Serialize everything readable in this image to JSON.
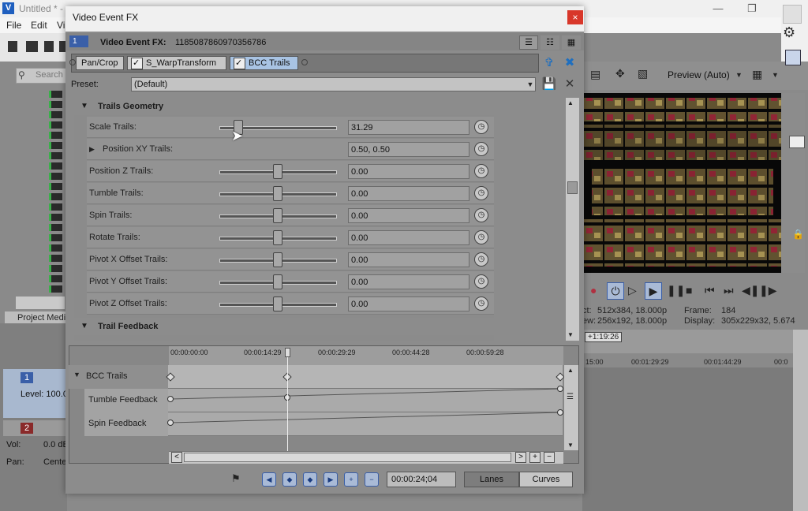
{
  "app": {
    "title": "Untitled * -",
    "menu": [
      "File",
      "Edit",
      "Vi"
    ],
    "search_placeholder": "Search",
    "project_media_tab": "Project Medi",
    "track1": {
      "number": "1",
      "level_label": "Level: 100.0"
    },
    "track2": {
      "number": "2",
      "vol_label": "Vol:",
      "vol_value": "0.0 dB",
      "pan_label": "Pan:",
      "pan_value": "Cente"
    }
  },
  "preview": {
    "mode_label": "Preview (Auto)",
    "info": {
      "project_label": "ct:",
      "project_value": "512x384, 18.000p",
      "frame_label": "Frame:",
      "frame_value": "184",
      "preview_label": "ew:",
      "preview_value": "256x192, 18.000p",
      "display_label": "Display:",
      "display_value": "305x229x32, 5.674"
    },
    "timecode": "+1:19:26",
    "ruler_labels": [
      "15:00",
      "00:01:29:29",
      "00:01:44:29",
      "00:0"
    ]
  },
  "dialog": {
    "title": "Video Event FX",
    "close_glyph": "×",
    "fx_badge": "1",
    "fx_title": "Video Event FX:",
    "fx_id": "1185087860970356786",
    "chain": [
      "Pan/Crop",
      "S_WarpTransform",
      "BCC Trails"
    ],
    "preset_label": "Preset:",
    "preset_value": "(Default)",
    "sections": {
      "geometry": "Trails Geometry",
      "feedback": "Trail Feedback"
    },
    "params": [
      {
        "label": "Scale Trails:",
        "value": "31.29",
        "level": 0.16
      },
      {
        "label": "Position XY Trails:",
        "value": "0.50, 0.50",
        "expandable": true
      },
      {
        "label": "Position Z Trails:",
        "value": "0.00",
        "level": 0.5
      },
      {
        "label": "Tumble Trails:",
        "value": "0.00",
        "level": 0.5
      },
      {
        "label": "Spin Trails:",
        "value": "0.00",
        "level": 0.5
      },
      {
        "label": "Rotate Trails:",
        "value": "0.00",
        "level": 0.5
      },
      {
        "label": "Pivot X Offset Trails:",
        "value": "0.00",
        "level": 0.5
      },
      {
        "label": "Pivot Y Offset Trails:",
        "value": "0.00",
        "level": 0.5
      },
      {
        "label": "Pivot Z Offset Trails:",
        "value": "0.00",
        "level": 0.5
      }
    ],
    "keyframes": {
      "ruler": [
        "00:00:00:00",
        "00:00:14:29",
        "00:00:29:29",
        "00:00:44:28",
        "00:00:59:28"
      ],
      "rows": [
        "BCC Trails",
        "Tumble Feedback",
        "Spin Feedback"
      ]
    },
    "time_field": "00:00:24;04",
    "lanes_label": "Lanes",
    "curves_label": "Curves"
  }
}
